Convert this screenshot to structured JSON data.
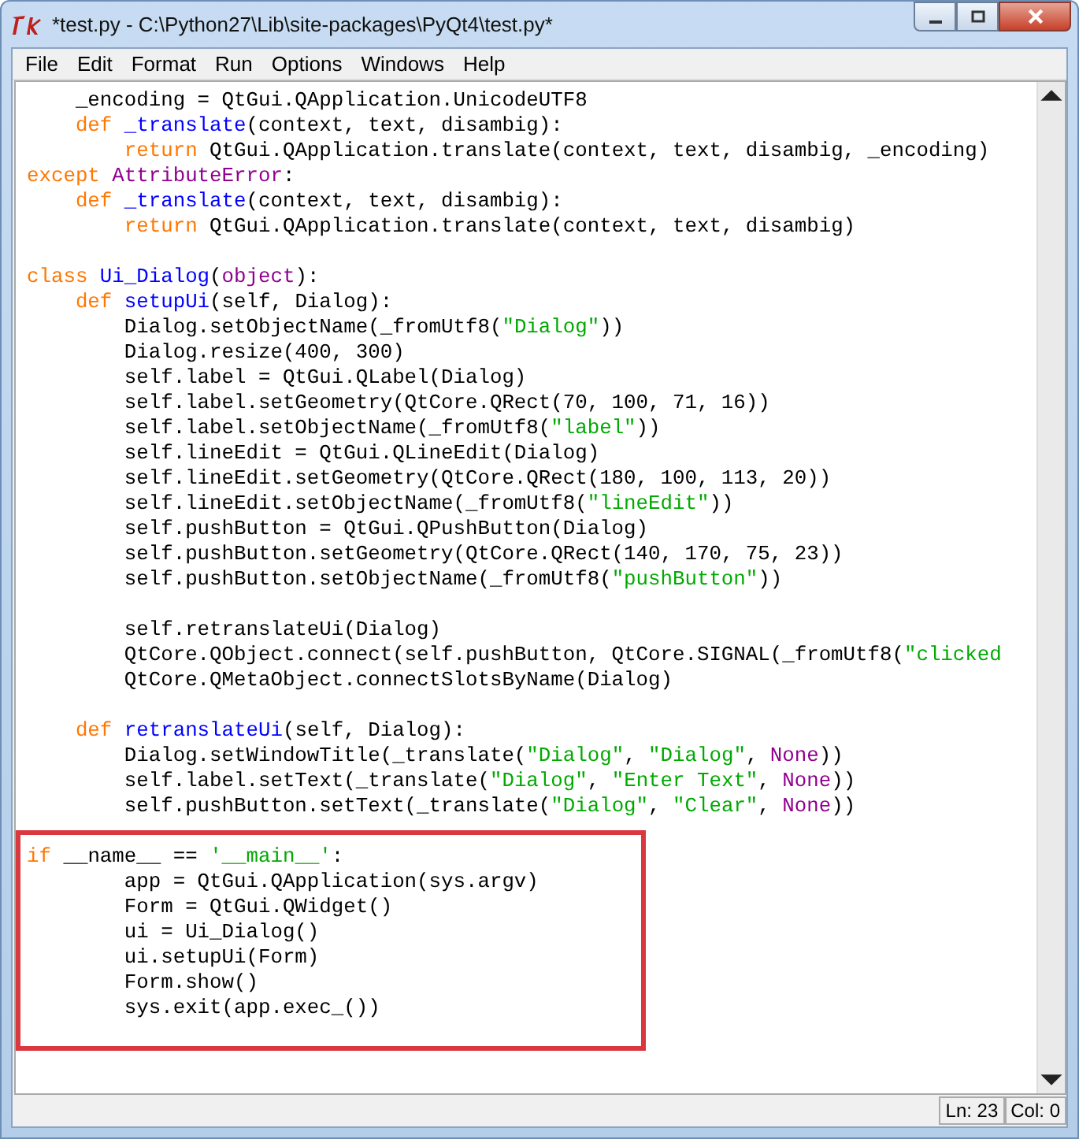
{
  "window": {
    "title": "*test.py - C:\\Python27\\Lib\\site-packages\\PyQt4\\test.py*"
  },
  "menu": [
    "File",
    "Edit",
    "Format",
    "Run",
    "Options",
    "Windows",
    "Help"
  ],
  "code": {
    "blocks": [
      {
        "lines": [
          {
            "tokens": [
              {
                "kind": "plain",
                "text": "    _encoding = QtGui.QApplication.UnicodeUTF8"
              }
            ]
          },
          {
            "tokens": [
              {
                "kind": "keyword",
                "text": "    def"
              },
              {
                "kind": "name",
                "text": " _translate"
              },
              {
                "kind": "plain",
                "text": "(context, text, disambig):"
              }
            ]
          },
          {
            "tokens": [
              {
                "kind": "keyword",
                "text": "        return"
              },
              {
                "kind": "plain",
                "text": " QtGui.QApplication.translate(context, text, disambig, _encoding)"
              }
            ]
          },
          {
            "tokens": [
              {
                "kind": "keyword",
                "text": "except"
              },
              {
                "kind": "builtin",
                "text": " AttributeError"
              },
              {
                "kind": "plain",
                "text": ":"
              }
            ]
          },
          {
            "tokens": [
              {
                "kind": "keyword",
                "text": "    def"
              },
              {
                "kind": "name",
                "text": " _translate"
              },
              {
                "kind": "plain",
                "text": "(context, text, disambig):"
              }
            ]
          },
          {
            "tokens": [
              {
                "kind": "keyword",
                "text": "        return"
              },
              {
                "kind": "plain",
                "text": " QtGui.QApplication.translate(context, text, disambig)"
              }
            ]
          }
        ]
      },
      {
        "lines": [
          {
            "tokens": [
              {
                "kind": "keyword",
                "text": "class"
              },
              {
                "kind": "name",
                "text": " Ui_Dialog"
              },
              {
                "kind": "plain",
                "text": "("
              },
              {
                "kind": "builtin",
                "text": "object"
              },
              {
                "kind": "plain",
                "text": "):"
              }
            ]
          },
          {
            "tokens": [
              {
                "kind": "keyword",
                "text": "    def"
              },
              {
                "kind": "name",
                "text": " setupUi"
              },
              {
                "kind": "plain",
                "text": "(self, Dialog):"
              }
            ]
          },
          {
            "tokens": [
              {
                "kind": "plain",
                "text": "        Dialog.setObjectName(_fromUtf8("
              },
              {
                "kind": "string",
                "text": "\"Dialog\""
              },
              {
                "kind": "plain",
                "text": "))"
              }
            ]
          },
          {
            "tokens": [
              {
                "kind": "plain",
                "text": "        Dialog.resize(400, 300)"
              }
            ]
          },
          {
            "tokens": [
              {
                "kind": "plain",
                "text": "        self.label = QtGui.QLabel(Dialog)"
              }
            ]
          },
          {
            "tokens": [
              {
                "kind": "plain",
                "text": "        self.label.setGeometry(QtCore.QRect(70, 100, 71, 16))"
              }
            ]
          },
          {
            "tokens": [
              {
                "kind": "plain",
                "text": "        self.label.setObjectName(_fromUtf8("
              },
              {
                "kind": "string",
                "text": "\"label\""
              },
              {
                "kind": "plain",
                "text": "))"
              }
            ]
          },
          {
            "tokens": [
              {
                "kind": "plain",
                "text": "        self.lineEdit = QtGui.QLineEdit(Dialog)"
              }
            ]
          },
          {
            "tokens": [
              {
                "kind": "plain",
                "text": "        self.lineEdit.setGeometry(QtCore.QRect(180, 100, 113, 20))"
              }
            ]
          },
          {
            "tokens": [
              {
                "kind": "plain",
                "text": "        self.lineEdit.setObjectName(_fromUtf8("
              },
              {
                "kind": "string",
                "text": "\"lineEdit\""
              },
              {
                "kind": "plain",
                "text": "))"
              }
            ]
          },
          {
            "tokens": [
              {
                "kind": "plain",
                "text": "        self.pushButton = QtGui.QPushButton(Dialog)"
              }
            ]
          },
          {
            "tokens": [
              {
                "kind": "plain",
                "text": "        self.pushButton.setGeometry(QtCore.QRect(140, 170, 75, 23))"
              }
            ]
          },
          {
            "tokens": [
              {
                "kind": "plain",
                "text": "        self.pushButton.setObjectName(_fromUtf8("
              },
              {
                "kind": "string",
                "text": "\"pushButton\""
              },
              {
                "kind": "plain",
                "text": "))"
              }
            ]
          }
        ]
      },
      {
        "lines": [
          {
            "tokens": [
              {
                "kind": "plain",
                "text": "        self.retranslateUi(Dialog)"
              }
            ]
          },
          {
            "tokens": [
              {
                "kind": "plain",
                "text": "        QtCore.QObject.connect(self.pushButton, QtCore.SIGNAL(_fromUtf8("
              },
              {
                "kind": "string",
                "text": "\"clicked"
              }
            ]
          },
          {
            "tokens": [
              {
                "kind": "plain",
                "text": "        QtCore.QMetaObject.connectSlotsByName(Dialog)"
              }
            ]
          }
        ]
      },
      {
        "lines": [
          {
            "tokens": [
              {
                "kind": "keyword",
                "text": "    def"
              },
              {
                "kind": "name",
                "text": " retranslateUi"
              },
              {
                "kind": "plain",
                "text": "(self, Dialog):"
              }
            ]
          },
          {
            "tokens": [
              {
                "kind": "plain",
                "text": "        Dialog.setWindowTitle(_translate("
              },
              {
                "kind": "string",
                "text": "\"Dialog\""
              },
              {
                "kind": "plain",
                "text": ", "
              },
              {
                "kind": "string",
                "text": "\"Dialog\""
              },
              {
                "kind": "plain",
                "text": ", "
              },
              {
                "kind": "builtin",
                "text": "None"
              },
              {
                "kind": "plain",
                "text": "))"
              }
            ]
          },
          {
            "tokens": [
              {
                "kind": "plain",
                "text": "        self.label.setText(_translate("
              },
              {
                "kind": "string",
                "text": "\"Dialog\""
              },
              {
                "kind": "plain",
                "text": ", "
              },
              {
                "kind": "string",
                "text": "\"Enter Text\""
              },
              {
                "kind": "plain",
                "text": ", "
              },
              {
                "kind": "builtin",
                "text": "None"
              },
              {
                "kind": "plain",
                "text": "))"
              }
            ]
          },
          {
            "tokens": [
              {
                "kind": "plain",
                "text": "        self.pushButton.setText(_translate("
              },
              {
                "kind": "string",
                "text": "\"Dialog\""
              },
              {
                "kind": "plain",
                "text": ", "
              },
              {
                "kind": "string",
                "text": "\"Clear\""
              },
              {
                "kind": "plain",
                "text": ", "
              },
              {
                "kind": "builtin",
                "text": "None"
              },
              {
                "kind": "plain",
                "text": "))"
              }
            ]
          }
        ]
      }
    ],
    "highlighted_lines": [
      {
        "tokens": [
          {
            "kind": "keyword",
            "text": "if"
          },
          {
            "kind": "plain",
            "text": " __name__ == "
          },
          {
            "kind": "string",
            "text": "'__main__'"
          },
          {
            "kind": "plain",
            "text": ":"
          }
        ]
      },
      {
        "tokens": [
          {
            "kind": "plain",
            "text": "        app = QtGui.QApplication(sys.argv)"
          }
        ]
      },
      {
        "tokens": [
          {
            "kind": "plain",
            "text": "        Form = QtGui.QWidget()"
          }
        ]
      },
      {
        "tokens": [
          {
            "kind": "plain",
            "text": "        ui = Ui_Dialog()"
          }
        ]
      },
      {
        "tokens": [
          {
            "kind": "plain",
            "text": "        ui.setupUi(Form)"
          }
        ]
      },
      {
        "tokens": [
          {
            "kind": "plain",
            "text": "        Form.show()"
          }
        ]
      },
      {
        "tokens": [
          {
            "kind": "plain",
            "text": "        sys.exit(app.exec_())"
          }
        ]
      }
    ]
  },
  "status_bar": {
    "line": "Ln: 23",
    "column": "Col: 0"
  }
}
